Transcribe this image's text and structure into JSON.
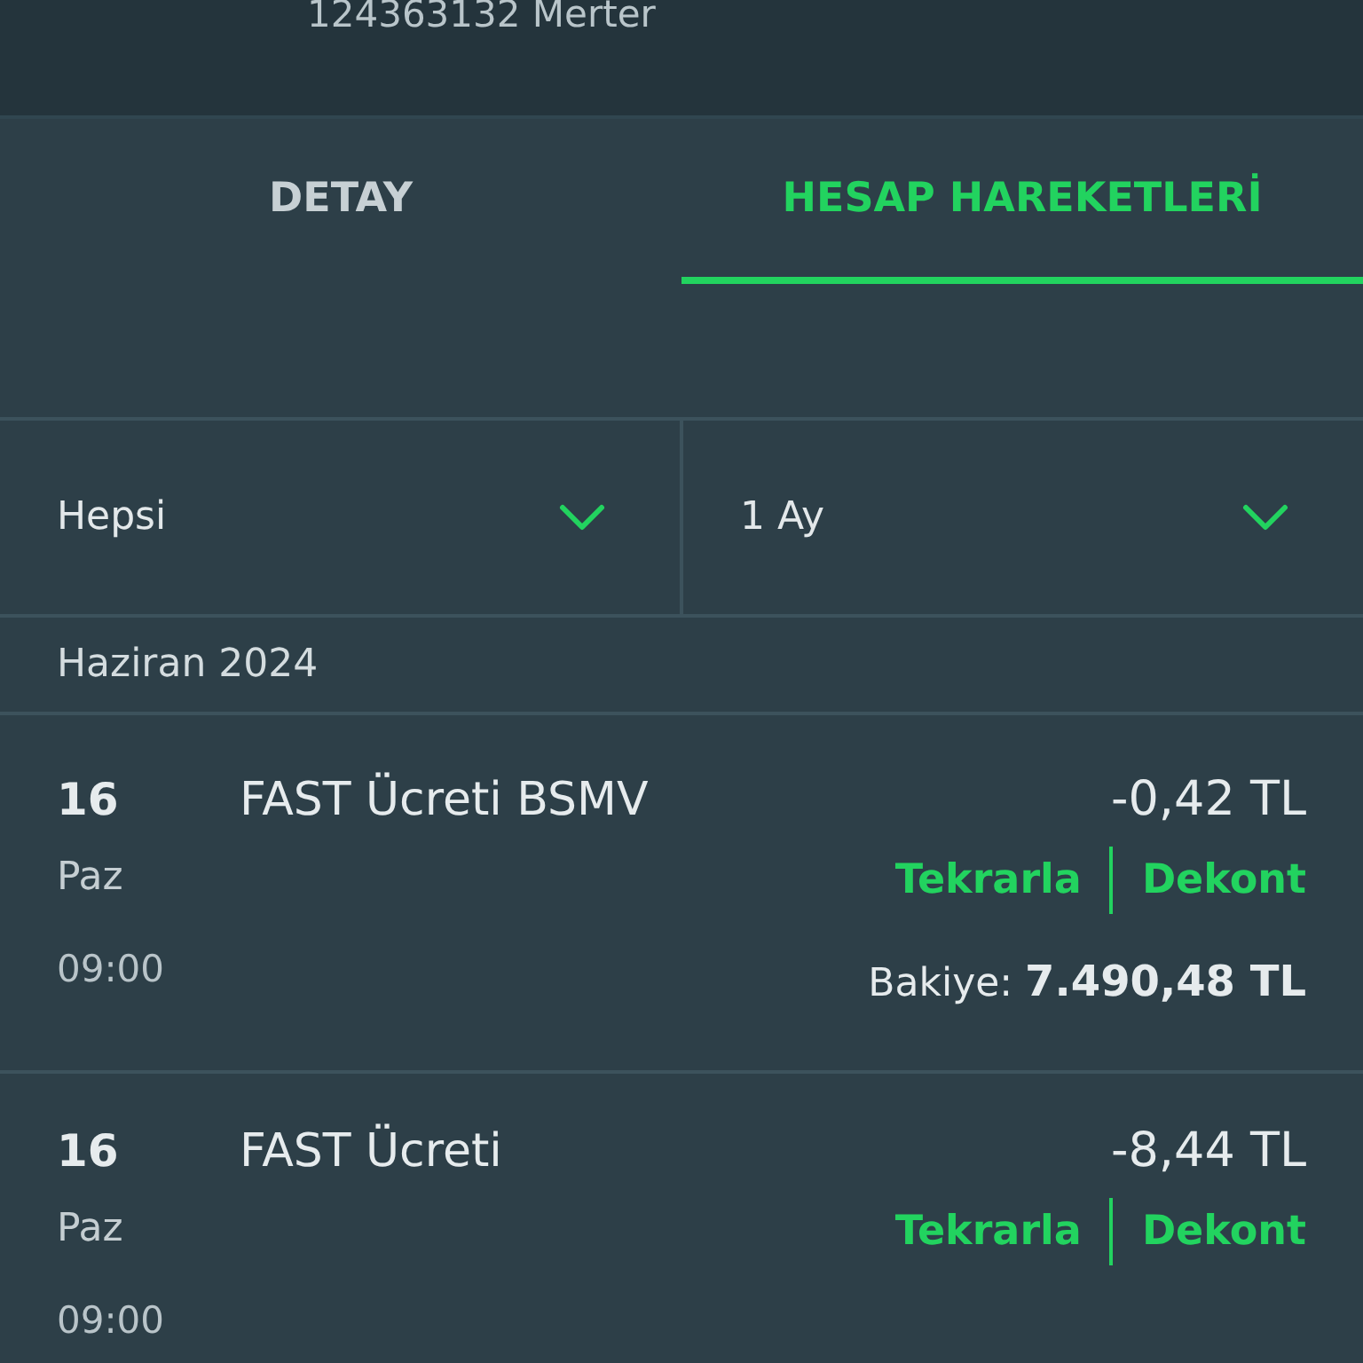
{
  "header": {
    "account": "124363132 Merter"
  },
  "tabs": [
    {
      "label": "DETAY",
      "selected": false
    },
    {
      "label": "HESAP HAREKETLERİ",
      "selected": true
    }
  ],
  "filters": [
    {
      "value": "Hepsi"
    },
    {
      "value": "1 Ay"
    }
  ],
  "month": "Haziran 2024",
  "transactions": [
    {
      "day": "16",
      "weekday": "Paz",
      "time": "09:00",
      "description": "FAST Ücreti BSMV",
      "amount": "-0,42",
      "currency": "TL",
      "actions": [
        "Tekrarla",
        "Dekont"
      ],
      "balance_label": "Bakiye:",
      "balance": "7.490,48",
      "balance_currency": "TL"
    },
    {
      "day": "16",
      "weekday": "Paz",
      "time": "09:00",
      "description": "FAST Ücreti",
      "amount": "-8,44",
      "currency": "TL",
      "actions": [
        "Tekrarla",
        "Dekont"
      ]
    }
  ]
}
